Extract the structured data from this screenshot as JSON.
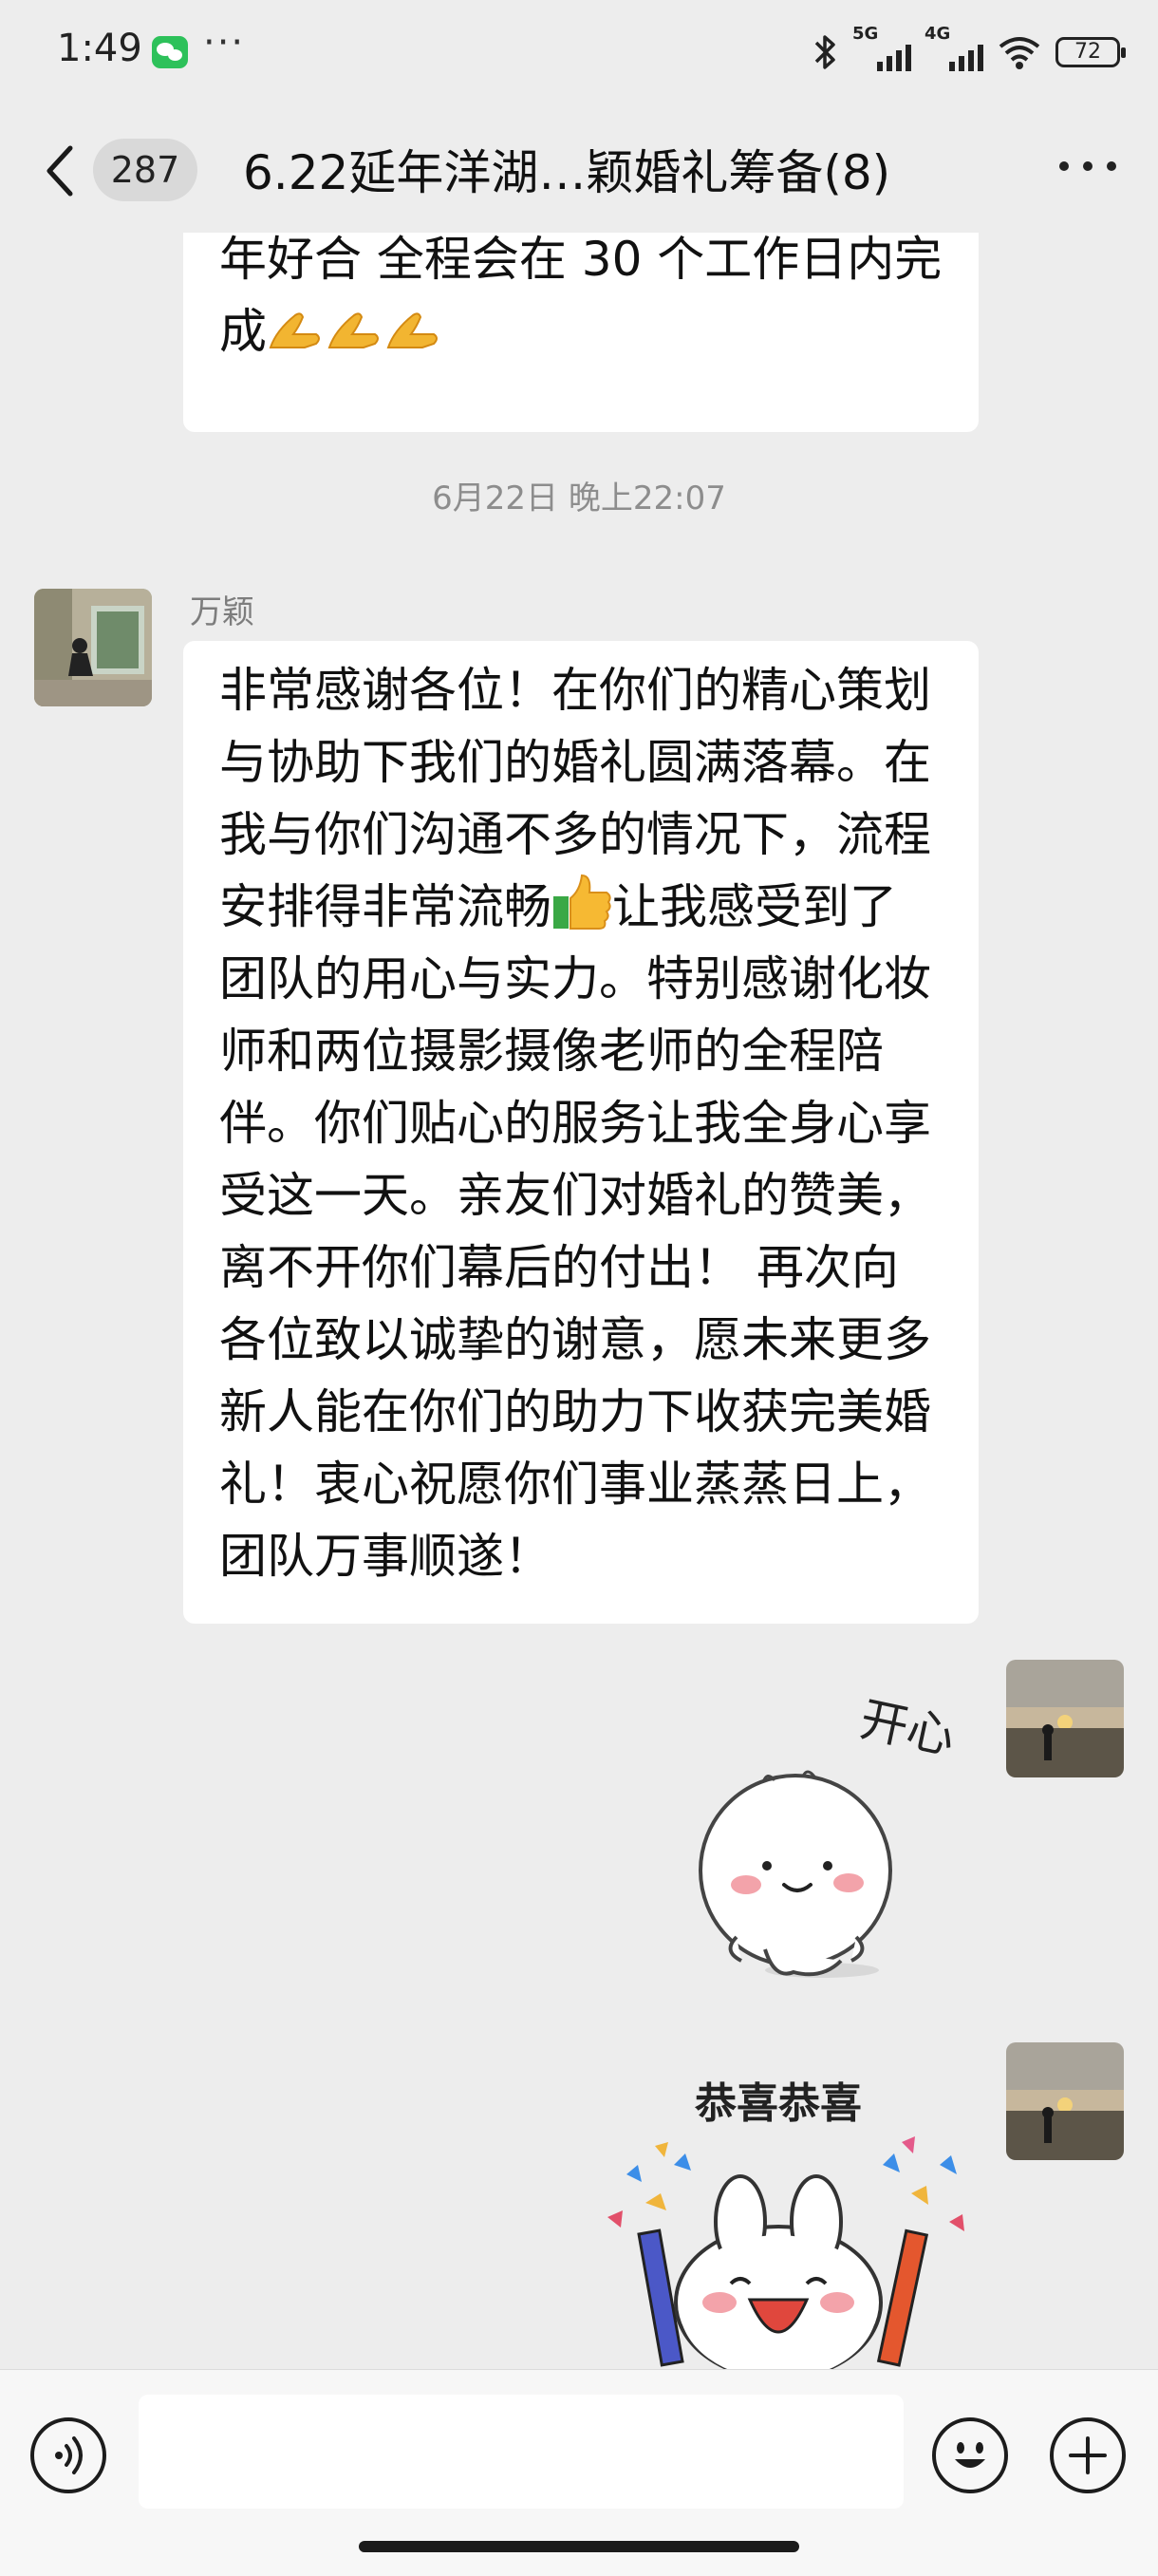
{
  "status_bar": {
    "time": "1:49",
    "more": "···",
    "net1": "5G",
    "net2": "4G",
    "battery": "72"
  },
  "header": {
    "unread_count": "287",
    "title": "6.22延年洋湖…颖婚礼筹备(8)"
  },
  "messages": {
    "prev_bubble_lines": [
      "年好合 全程会在 30 个工作日内完",
      "成"
    ],
    "timestamp": "6月22日 晚上22:07",
    "sender_name": "万颖",
    "main_lines": [
      "非常感谢各位！在你们的精心策划",
      "与协助下我们的婚礼圆满落幕。在",
      "我与你们沟通不多的情况下，流程",
      "安排得非常流畅",
      "让我感受到了",
      "团队的用心与实力。特别感谢化妆",
      "师和两位摄影摄像老师的全程陪",
      "伴。你们贴心的服务让我全身心享",
      "受这一天。亲友们对婚礼的赞美，",
      "离不开你们幕后的付出！ 再次向",
      "各位致以诚挚的谢意，愿未来更多",
      "新人能在你们的助力下收获完美婚",
      "礼！衷心祝愿你们事业蒸蒸日上，",
      "团队万事顺遂！"
    ],
    "sticker1_text": "开心",
    "sticker2_text": "恭喜恭喜"
  },
  "icons": {
    "back": "chevron-left-icon",
    "more": "more-dots-icon",
    "pray": "pray-hands-emoji",
    "thumb": "thumbs-up-emoji",
    "voice": "voice-icon",
    "emoji": "emoji-icon",
    "plus": "plus-icon"
  },
  "colors": {
    "background": "#ededed",
    "bubble": "#ffffff",
    "wechat_green": "#2dc15a"
  }
}
